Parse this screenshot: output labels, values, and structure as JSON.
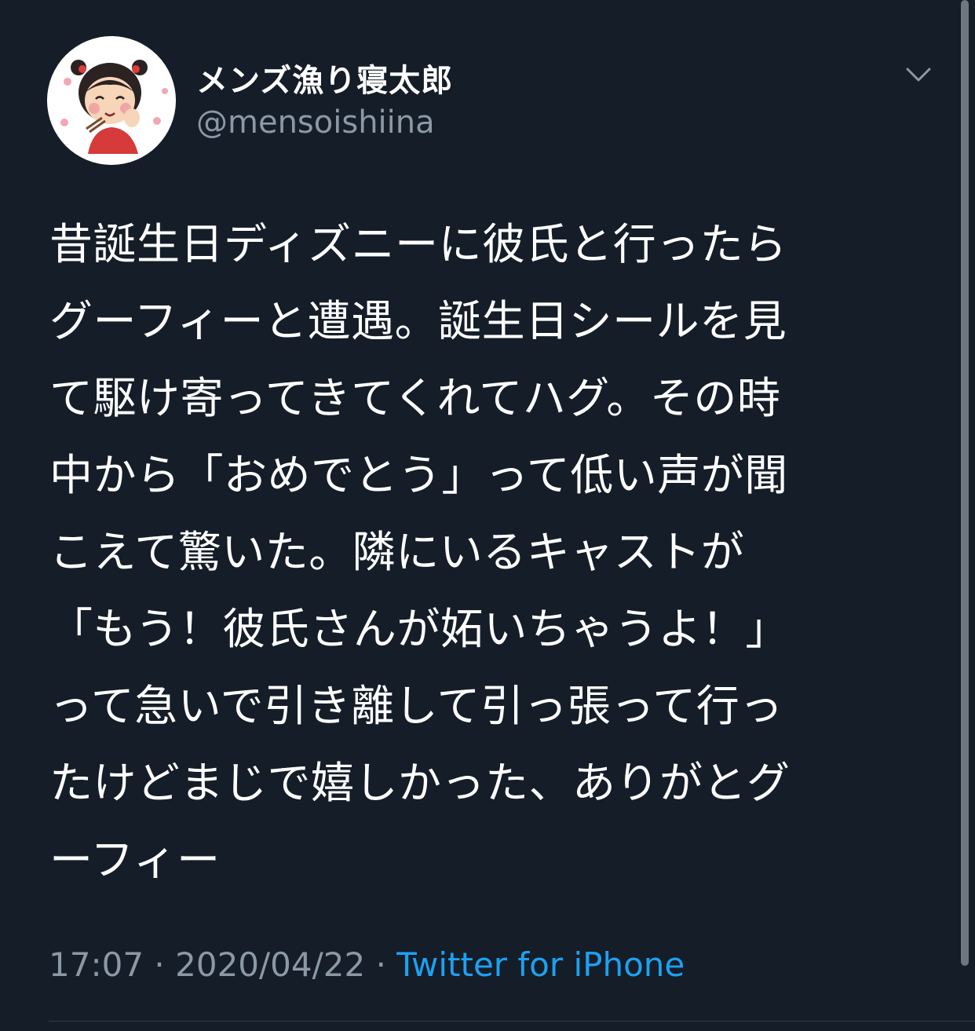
{
  "user": {
    "name": "メンズ漁り寝太郎",
    "handle": "@mensoishiina"
  },
  "tweet": {
    "lines": [
      "昔誕生日ディズニーに彼氏と行ったら",
      "グーフィーと遭遇。誕生日シールを見",
      "て駆け寄ってきてくれてハグ。その時",
      "中から「おめでとう」って低い声が聞",
      "こえて驚いた。隣にいるキャストが",
      "「もう！彼氏さんが妬いちゃうよ！」",
      "って急いで引き離して引っ張って行っ",
      "たけどまじで嬉しかった、ありがとグ",
      "ーフィー"
    ]
  },
  "meta": {
    "time": "17:07",
    "separator": "·",
    "date": "2020/04/22",
    "source": "Twitter for iPhone"
  },
  "icons": {
    "avatar": "girl-eating-illustration",
    "menu": "chevron-down-icon"
  },
  "colors": {
    "background": "#151d28",
    "text": "#ffffff",
    "secondary_text": "#8b98a5",
    "link": "#1da1f2"
  }
}
